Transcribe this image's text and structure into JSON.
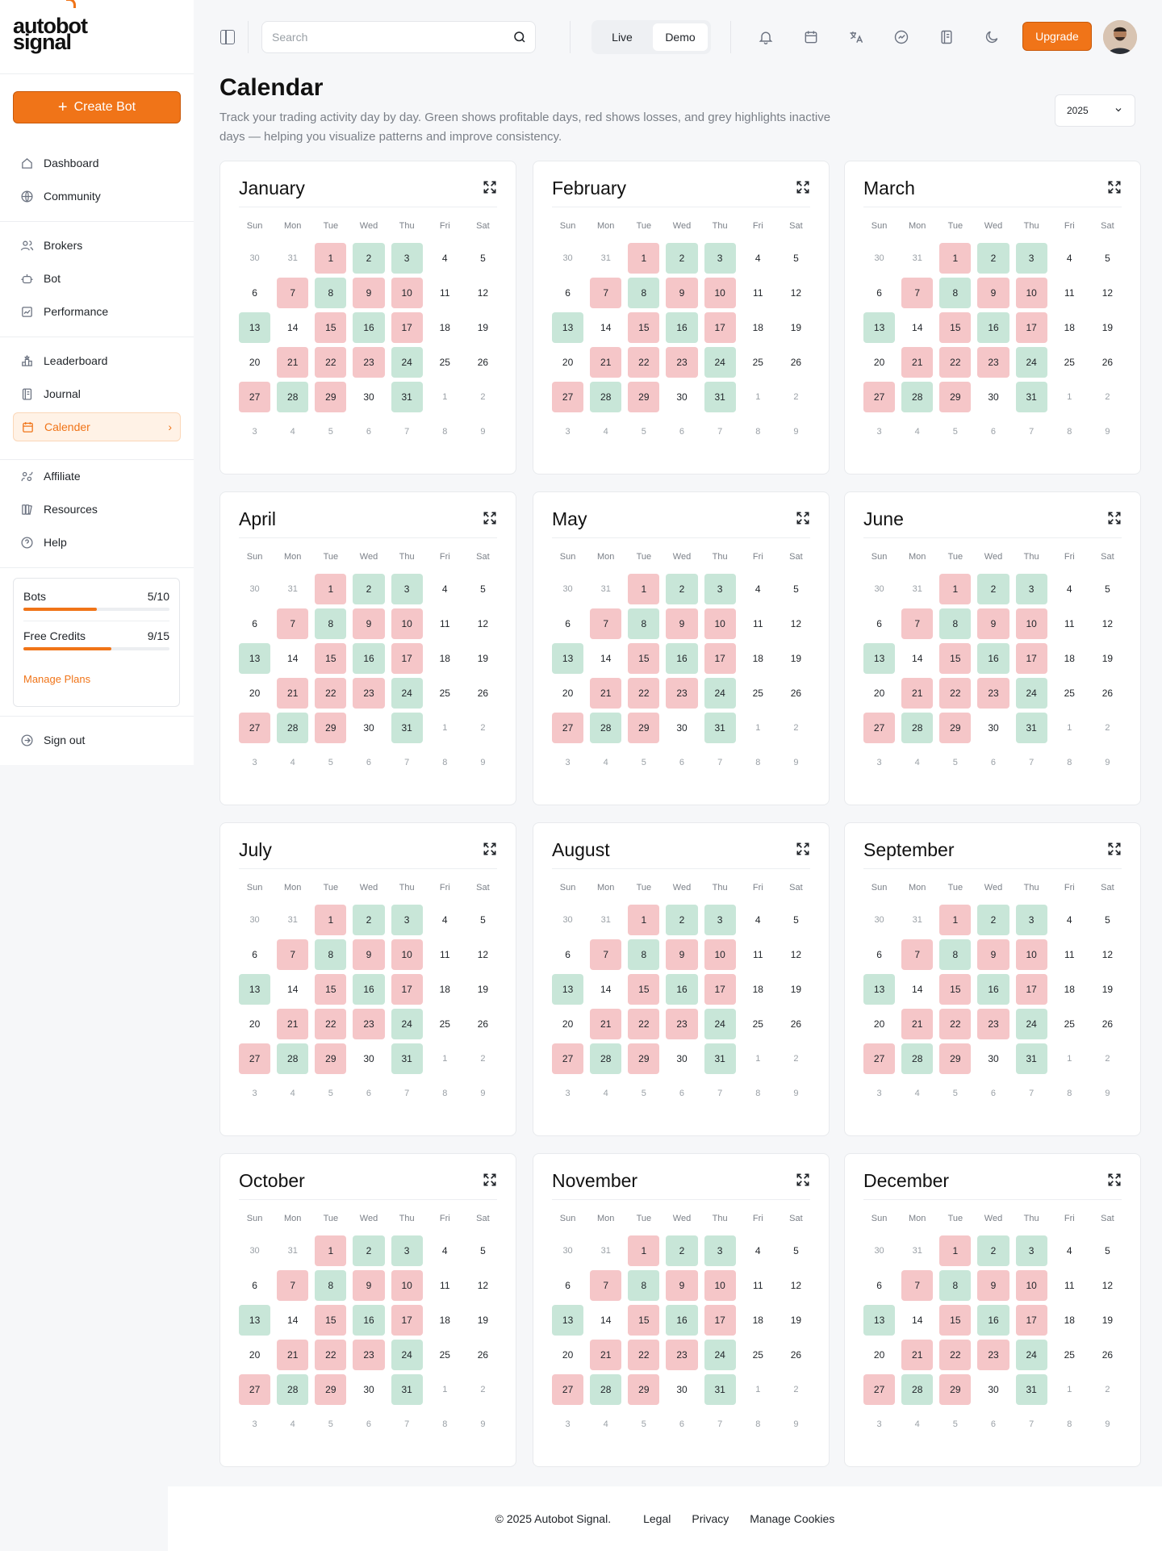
{
  "brand": {
    "line1": "autobot",
    "line2": "signal"
  },
  "sidebar": {
    "create_label": "Create Bot",
    "nav": [
      {
        "label": "Dashboard",
        "icon": "home-icon"
      },
      {
        "label": "Community",
        "icon": "globe-icon"
      },
      {
        "label": "Brokers",
        "icon": "users-icon"
      },
      {
        "label": "Bot",
        "icon": "robot-icon"
      },
      {
        "label": "Performance",
        "icon": "chart-icon"
      },
      {
        "label": "Leaderboard",
        "icon": "podium-icon"
      },
      {
        "label": "Journal",
        "icon": "journal-icon"
      },
      {
        "label": "Calender",
        "icon": "calendar-icon",
        "active": true
      },
      {
        "label": "Affiliate",
        "icon": "affiliate-icon"
      },
      {
        "label": "Resources",
        "icon": "books-icon"
      },
      {
        "label": "Help",
        "icon": "help-icon"
      }
    ],
    "usage": {
      "bots_label": "Bots",
      "bots_value": "5/10",
      "bots_fraction": 0.5,
      "credits_label": "Free Credits",
      "credits_value": "9/15",
      "credits_fraction": 0.6,
      "manage_label": "Manage Plans"
    },
    "signout_label": "Sign out"
  },
  "topbar": {
    "search_placeholder": "Search",
    "mode_live": "Live",
    "mode_demo": "Demo",
    "mode_selected": "Demo",
    "upgrade_label": "Upgrade"
  },
  "page": {
    "title": "Calendar",
    "subtitle": "Track your trading activity day by day. Green shows profitable days, red shows losses, and grey highlights inactive days — helping you visualize patterns and improve consistency.",
    "year": "2025"
  },
  "weekdays": [
    "Sun",
    "Mon",
    "Tue",
    "Wed",
    "Thu",
    "Fri",
    "Sat"
  ],
  "months": [
    "January",
    "February",
    "March",
    "April",
    "May",
    "June",
    "July",
    "August",
    "September",
    "October",
    "November",
    "December"
  ],
  "calendar_days": [
    [
      "30",
      "o"
    ],
    [
      "31",
      "o"
    ],
    [
      "1",
      "r"
    ],
    [
      "2",
      "g"
    ],
    [
      "3",
      "g"
    ],
    [
      "4",
      ""
    ],
    [
      "5",
      ""
    ],
    [
      "6",
      ""
    ],
    [
      "7",
      "r"
    ],
    [
      "8",
      "g"
    ],
    [
      "9",
      "r"
    ],
    [
      "10",
      "r"
    ],
    [
      "11",
      ""
    ],
    [
      "12",
      ""
    ],
    [
      "13",
      "g"
    ],
    [
      "14",
      ""
    ],
    [
      "15",
      "r"
    ],
    [
      "16",
      "g"
    ],
    [
      "17",
      "r"
    ],
    [
      "18",
      ""
    ],
    [
      "19",
      ""
    ],
    [
      "20",
      ""
    ],
    [
      "21",
      "r"
    ],
    [
      "22",
      "r"
    ],
    [
      "23",
      "r"
    ],
    [
      "24",
      "g"
    ],
    [
      "25",
      ""
    ],
    [
      "26",
      ""
    ],
    [
      "27",
      "r"
    ],
    [
      "28",
      "g"
    ],
    [
      "29",
      "r"
    ],
    [
      "30",
      ""
    ],
    [
      "31",
      "g"
    ],
    [
      "1",
      "o"
    ],
    [
      "2",
      "o"
    ],
    [
      "3",
      "o"
    ],
    [
      "4",
      "o"
    ],
    [
      "5",
      "o"
    ],
    [
      "6",
      "o"
    ],
    [
      "7",
      "o"
    ],
    [
      "8",
      "o"
    ],
    [
      "9",
      "o"
    ]
  ],
  "colors": {
    "accent": "#f07418",
    "profit": "#c8e6d8",
    "loss": "#f5c6c8"
  },
  "footer": {
    "copyright": "© 2025 Autobot Signal.",
    "links": [
      "Legal",
      "Privacy",
      "Manage Cookies"
    ]
  }
}
